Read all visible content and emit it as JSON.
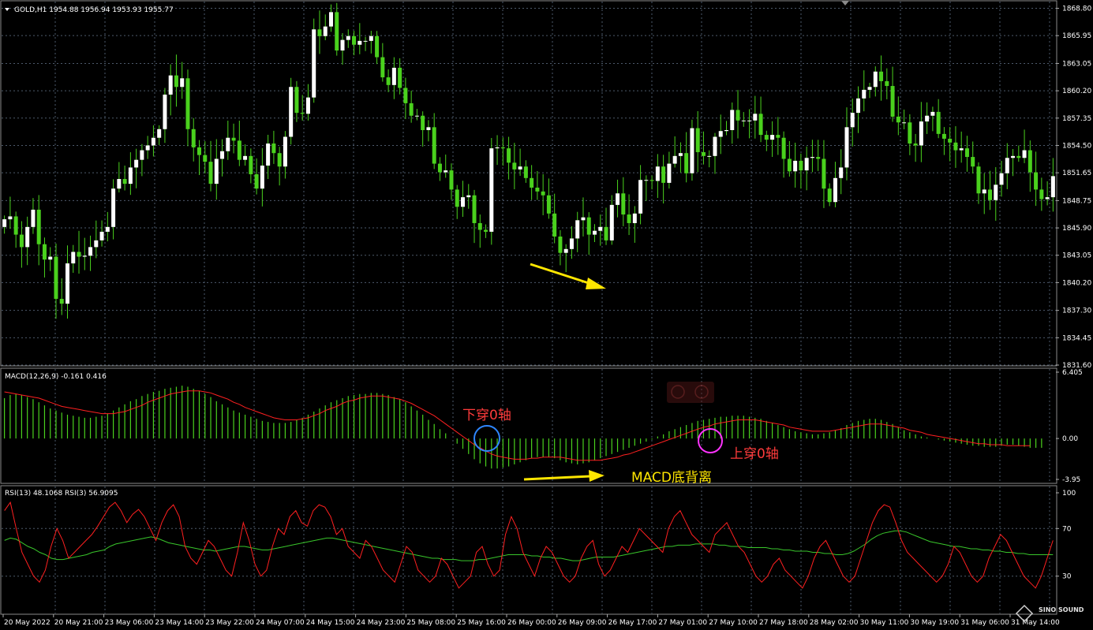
{
  "main_panel": {
    "header": "GOLD,H1  1954.88 1956.94 1953.93 1955.77",
    "price_labels": [
      "1868.80",
      "1865.95",
      "1863.05",
      "1860.20",
      "1857.35",
      "1854.50",
      "1851.65",
      "1848.75",
      "1845.90",
      "1843.05",
      "1840.20",
      "1837.30",
      "1834.45",
      "1831.60"
    ],
    "annotation_arrow": "yellow arrow pointing to price low"
  },
  "macd_panel": {
    "header": "MACD(12,26,9) -0.161 0.416",
    "scale_labels": [
      "6.405",
      "0.00",
      "-3.95"
    ],
    "annotation_cross_down": "下穿0轴",
    "annotation_cross_up": "上穿0轴",
    "annotation_divergence": "MACD底背离"
  },
  "rsi_panel": {
    "header": "RSI(13) 48.1068  RSI(3) 56.9095",
    "scale_labels": [
      "100",
      "70",
      "30"
    ]
  },
  "time_axis": {
    "labels": [
      "20 May 2022",
      "20 May 21:00",
      "23 May 06:00",
      "23 May 14:00",
      "23 May 22:00",
      "24 May 07:00",
      "24 May 15:00",
      "24 May 23:00",
      "25 May 08:00",
      "25 May 16:00",
      "26 May 00:00",
      "26 May 09:00",
      "26 May 17:00",
      "27 May 01:00",
      "27 May 10:00",
      "27 May 18:00",
      "28 May 02:00",
      "30 May 11:00",
      "30 May 19:00",
      "31 May 06:00",
      "31 May 14:00"
    ]
  },
  "watermark": {
    "text": "SINO SOUND"
  },
  "colors": {
    "bull": "#ffffff",
    "bear": "#4ad11d",
    "wick": "#4ad11d",
    "macd_hist": "#4ad11d",
    "macd_signal": "#ff2020",
    "rsi13": "#39c62b",
    "rsi3": "#ff2020",
    "grid": "#4d5a6b",
    "annotation_yellow": "#ffe600",
    "circle_blue": "#2e86ff",
    "circle_magenta": "#ff33ff",
    "text_red": "#ff3b3b"
  },
  "chart_data": [
    {
      "type": "candlestick",
      "title": "GOLD,H1",
      "ylim": [
        1831.6,
        1869.5
      ],
      "values": [
        1846.8,
        1847.1,
        1845.2,
        1843.9,
        1846.0,
        1847.8,
        1844.2,
        1842.6,
        1842.9,
        1838.5,
        1838.0,
        1842.2,
        1843.4,
        1842.9,
        1843.0,
        1843.9,
        1844.6,
        1845.5,
        1846.0,
        1850.0,
        1851.0,
        1850.5,
        1852.2,
        1853.0,
        1854.0,
        1854.5,
        1855.3,
        1856.2,
        1859.8,
        1861.8,
        1860.6,
        1861.5,
        1856.2,
        1854.3,
        1853.5,
        1852.8,
        1850.5,
        1853.1,
        1853.9,
        1855.3,
        1855.0,
        1853.0,
        1853.4,
        1851.5,
        1850.0,
        1852.4,
        1854.7,
        1853.7,
        1852.3,
        1855.4,
        1860.6,
        1857.9,
        1857.8,
        1859.5,
        1866.6,
        1865.9,
        1866.9,
        1868.4,
        1864.4,
        1865.5,
        1865.9,
        1865.0,
        1865.4,
        1865.4,
        1865.9,
        1863.7,
        1861.6,
        1860.8,
        1862.6,
        1860.5,
        1858.9,
        1857.6,
        1857.6,
        1856.1,
        1856.4,
        1852.6,
        1851.7,
        1851.9,
        1849.9,
        1848.1,
        1849.1,
        1849.3,
        1846.4,
        1845.7,
        1845.5,
        1854.2,
        1854.3,
        1854.2,
        1852.7,
        1852.0,
        1852.3,
        1851.1,
        1850.1,
        1849.7,
        1849.3,
        1847.4,
        1845.0,
        1843.3,
        1843.7,
        1844.8,
        1846.7,
        1847.0,
        1845.2,
        1845.6,
        1846.0,
        1844.6,
        1848.3,
        1849.5,
        1847.3,
        1846.4,
        1847.4,
        1850.9,
        1850.9,
        1850.8,
        1852.3,
        1850.6,
        1852.6,
        1853.4,
        1853.7,
        1851.6,
        1856.3,
        1853.8,
        1853.4,
        1853.4,
        1855.4,
        1856.0,
        1856.1,
        1858.2,
        1857.1,
        1857.1,
        1857.1,
        1857.8,
        1855.6,
        1855.1,
        1855.6,
        1855.3,
        1853.1,
        1851.8,
        1852.9,
        1851.9,
        1853.2,
        1853.3,
        1853.1,
        1850.0,
        1848.6,
        1851.1,
        1852.2,
        1856.4,
        1857.9,
        1859.4,
        1860.3,
        1860.6,
        1862.2,
        1861.2,
        1860.7,
        1857.5,
        1856.9,
        1856.9,
        1854.7,
        1854.5,
        1857.0,
        1857.6,
        1858.0,
        1855.7,
        1855.2,
        1854.8,
        1854.0,
        1854.2,
        1853.3,
        1852.3,
        1849.5,
        1849.9,
        1848.8,
        1850.4,
        1851.6,
        1853.2,
        1853.4,
        1853.2,
        1854.0,
        1851.7,
        1849.9,
        1848.9,
        1849.1,
        1851.3
      ],
      "ylabel": ""
    },
    {
      "type": "bar",
      "title": "MACD(12,26,9)",
      "current_values": {
        "macd": -0.161,
        "signal": 0.416
      },
      "ylim": [
        -3.95,
        6.405
      ],
      "histogram": [
        3.9,
        4.2,
        4.3,
        4.2,
        4.0,
        3.8,
        3.5,
        3.2,
        2.9,
        2.7,
        2.5,
        2.3,
        2.2,
        2.1,
        2.0,
        2.0,
        2.1,
        2.2,
        2.4,
        2.7,
        3.0,
        3.3,
        3.6,
        3.8,
        4.1,
        4.3,
        4.5,
        4.6,
        4.8,
        4.9,
        5.0,
        5.1,
        5.0,
        4.8,
        4.6,
        4.3,
        4.0,
        3.6,
        3.3,
        3.0,
        2.7,
        2.5,
        2.3,
        2.1,
        1.9,
        1.7,
        1.6,
        1.5,
        1.5,
        1.5,
        1.6,
        1.8,
        2.0,
        2.3,
        2.6,
        2.9,
        3.2,
        3.5,
        3.7,
        3.9,
        4.1,
        4.2,
        4.3,
        4.3,
        4.4,
        4.4,
        4.3,
        4.2,
        4.0,
        3.8,
        3.5,
        3.1,
        2.7,
        2.3,
        1.8,
        1.4,
        0.9,
        0.5,
        0.0,
        -0.5,
        -1.0,
        -1.5,
        -2.0,
        -2.4,
        -2.7,
        -2.9,
        -2.9,
        -2.8,
        -2.7,
        -2.5,
        -2.3,
        -2.1,
        -1.9,
        -1.8,
        -1.8,
        -1.8,
        -1.9,
        -2.1,
        -2.3,
        -2.4,
        -2.5,
        -2.4,
        -2.3,
        -2.1,
        -1.9,
        -1.7,
        -1.5,
        -1.3,
        -1.1,
        -0.9,
        -0.7,
        -0.5,
        -0.3,
        -0.1,
        0.2,
        0.4,
        0.7,
        0.9,
        1.1,
        1.3,
        1.5,
        1.7,
        1.8,
        1.9,
        2.0,
        2.1,
        2.1,
        2.2,
        2.2,
        2.2,
        2.1,
        2.0,
        1.9,
        1.7,
        1.5,
        1.3,
        1.1,
        0.9,
        0.7,
        0.6,
        0.5,
        0.4,
        0.4,
        0.5,
        0.6,
        0.8,
        1.0,
        1.3,
        1.5,
        1.7,
        1.8,
        1.9,
        1.9,
        1.8,
        1.6,
        1.4,
        1.1,
        0.8,
        0.6,
        0.4,
        0.2,
        0.1,
        0.0,
        -0.1,
        -0.2,
        -0.3,
        -0.4,
        -0.5,
        -0.6,
        -0.7,
        -0.7,
        -0.8,
        -0.8,
        -0.8,
        -0.7,
        -0.6,
        -0.6,
        -0.7,
        -0.8,
        -0.9,
        -0.9,
        -0.9
      ],
      "signal": [
        4.5,
        4.4,
        4.3,
        4.2,
        4.1,
        4.0,
        3.9,
        3.7,
        3.5,
        3.3,
        3.1,
        3.0,
        2.9,
        2.8,
        2.7,
        2.6,
        2.5,
        2.4,
        2.4,
        2.4,
        2.5,
        2.6,
        2.8,
        3.0,
        3.2,
        3.5,
        3.7,
        3.9,
        4.1,
        4.3,
        4.4,
        4.5,
        4.6,
        4.6,
        4.6,
        4.5,
        4.4,
        4.2,
        4.0,
        3.8,
        3.5,
        3.3,
        3.0,
        2.8,
        2.6,
        2.4,
        2.2,
        2.0,
        1.9,
        1.8,
        1.8,
        1.8,
        1.9,
        2.0,
        2.2,
        2.4,
        2.7,
        2.9,
        3.1,
        3.4,
        3.6,
        3.7,
        3.9,
        4.0,
        4.1,
        4.1,
        4.1,
        4.0,
        3.9,
        3.8,
        3.6,
        3.4,
        3.1,
        2.8,
        2.5,
        2.2,
        1.8,
        1.4,
        1.0,
        0.6,
        0.2,
        -0.2,
        -0.6,
        -0.9,
        -1.2,
        -1.5,
        -1.7,
        -1.8,
        -1.9,
        -2.0,
        -2.0,
        -2.0,
        -1.9,
        -1.9,
        -1.8,
        -1.8,
        -1.8,
        -1.8,
        -1.9,
        -2.0,
        -2.1,
        -2.1,
        -2.1,
        -2.1,
        -2.1,
        -2.0,
        -1.9,
        -1.8,
        -1.6,
        -1.5,
        -1.3,
        -1.1,
        -0.9,
        -0.7,
        -0.5,
        -0.3,
        -0.1,
        0.1,
        0.3,
        0.5,
        0.7,
        0.9,
        1.1,
        1.2,
        1.4,
        1.5,
        1.6,
        1.7,
        1.8,
        1.8,
        1.8,
        1.8,
        1.7,
        1.6,
        1.5,
        1.4,
        1.3,
        1.1,
        1.0,
        0.9,
        0.8,
        0.7,
        0.7,
        0.7,
        0.7,
        0.8,
        0.9,
        1.0,
        1.1,
        1.2,
        1.3,
        1.4,
        1.4,
        1.4,
        1.3,
        1.2,
        1.1,
        1.0,
        0.8,
        0.7,
        0.6,
        0.4,
        0.3,
        0.2,
        0.1,
        0.0,
        -0.1,
        -0.2,
        -0.3,
        -0.4,
        -0.5,
        -0.5,
        -0.6,
        -0.6,
        -0.6,
        -0.7,
        -0.7,
        -0.7,
        -0.7,
        -0.7
      ],
      "ylabel": ""
    },
    {
      "type": "line",
      "title": "RSI",
      "ylim": [
        0,
        100
      ],
      "series": [
        {
          "name": "RSI(13) 48.1068",
          "values": [
            60,
            62,
            61,
            58,
            55,
            53,
            50,
            48,
            45,
            44,
            44,
            45,
            46,
            47,
            48,
            50,
            51,
            52,
            55,
            57,
            58,
            59,
            60,
            61,
            62,
            63,
            62,
            60,
            58,
            57,
            56,
            55,
            54,
            53,
            52,
            52,
            51,
            52,
            53,
            54,
            55,
            55,
            54,
            53,
            52,
            52,
            53,
            54,
            55,
            56,
            57,
            58,
            59,
            60,
            61,
            62,
            62,
            61,
            60,
            59,
            58,
            57,
            56,
            55,
            54,
            53,
            52,
            51,
            50,
            49,
            48,
            47,
            46,
            45,
            45,
            44,
            44,
            44,
            43,
            43,
            43,
            44,
            44,
            45,
            46,
            47,
            48,
            48,
            48,
            48,
            47,
            47,
            46,
            46,
            45,
            45,
            44,
            43,
            43,
            44,
            45,
            46,
            46,
            46,
            46,
            47,
            48,
            49,
            50,
            51,
            52,
            53,
            54,
            55,
            55,
            56,
            56,
            56,
            57,
            57,
            57,
            57,
            56,
            56,
            55,
            55,
            55,
            54,
            54,
            54,
            54,
            53,
            53,
            52,
            52,
            51,
            51,
            51,
            50,
            50,
            49,
            49,
            48,
            48,
            49,
            51,
            54,
            57,
            61,
            64,
            66,
            67,
            68,
            68,
            67,
            65,
            63,
            61,
            59,
            58,
            57,
            56,
            55,
            55,
            54,
            53,
            53,
            52,
            52,
            51,
            51,
            50,
            50,
            49,
            49,
            48,
            48,
            48,
            48,
            48
          ]
        },
        {
          "name": "RSI(3) 56.9095",
          "values": [
            85,
            92,
            70,
            50,
            40,
            30,
            25,
            35,
            55,
            70,
            60,
            45,
            50,
            55,
            60,
            65,
            72,
            80,
            88,
            92,
            85,
            75,
            82,
            86,
            80,
            70,
            60,
            75,
            85,
            90,
            80,
            55,
            45,
            40,
            50,
            60,
            55,
            45,
            35,
            30,
            50,
            75,
            60,
            40,
            30,
            35,
            55,
            70,
            65,
            80,
            85,
            75,
            72,
            85,
            90,
            88,
            80,
            65,
            70,
            55,
            50,
            45,
            60,
            55,
            45,
            35,
            30,
            25,
            40,
            55,
            50,
            35,
            30,
            25,
            30,
            45,
            40,
            30,
            20,
            25,
            30,
            50,
            55,
            40,
            30,
            35,
            65,
            80,
            70,
            50,
            40,
            30,
            45,
            55,
            50,
            40,
            30,
            25,
            30,
            45,
            55,
            60,
            40,
            30,
            35,
            45,
            55,
            50,
            60,
            70,
            65,
            60,
            55,
            50,
            70,
            80,
            85,
            75,
            65,
            60,
            55,
            50,
            65,
            70,
            75,
            65,
            55,
            50,
            40,
            30,
            25,
            30,
            40,
            45,
            35,
            30,
            25,
            20,
            30,
            45,
            55,
            60,
            50,
            40,
            30,
            25,
            30,
            45,
            60,
            75,
            85,
            90,
            88,
            75,
            60,
            50,
            45,
            40,
            35,
            30,
            25,
            30,
            40,
            55,
            50,
            40,
            30,
            25,
            30,
            45,
            55,
            65,
            60,
            50,
            40,
            30,
            25,
            20,
            30,
            45,
            60
          ]
        }
      ]
    }
  ]
}
